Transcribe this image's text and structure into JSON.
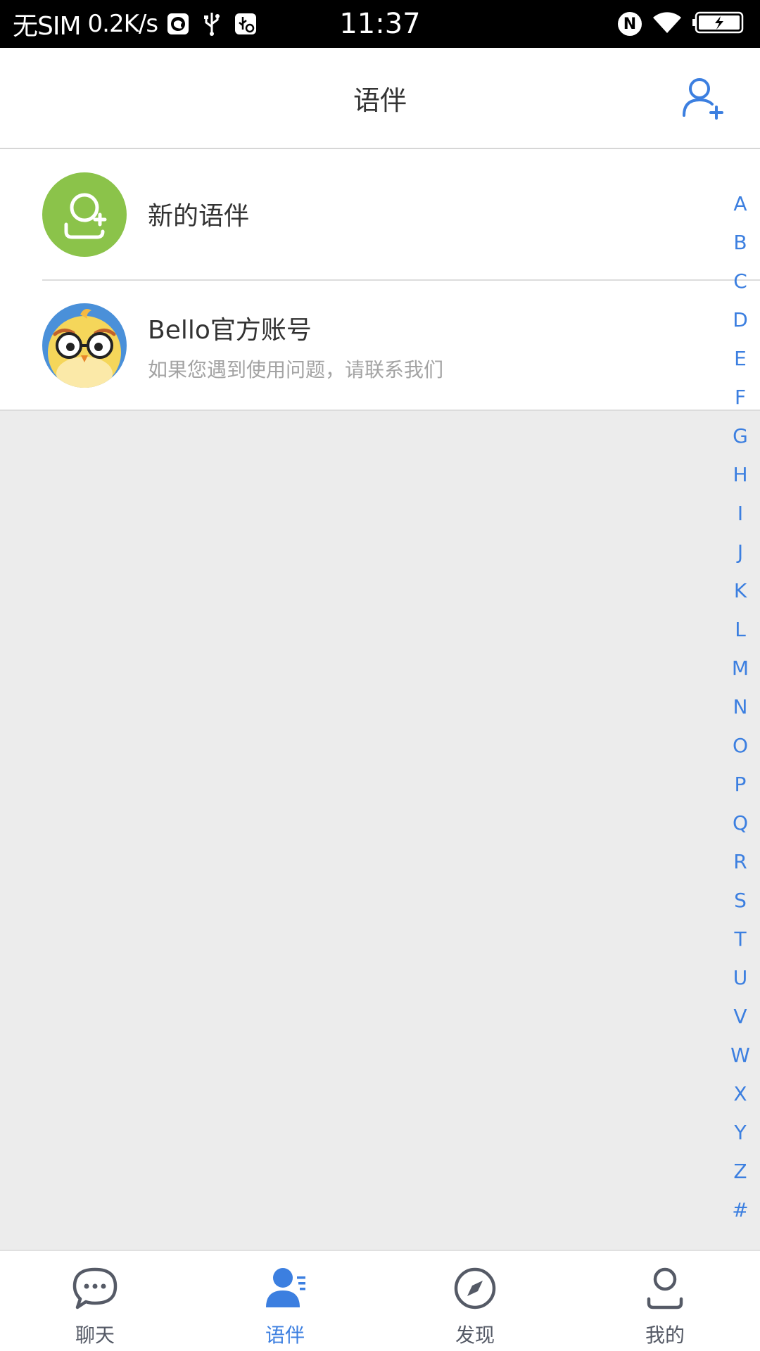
{
  "status_bar": {
    "carrier": "无SIM",
    "speed": "0.2K/s",
    "time": "11:37",
    "nfc": "N"
  },
  "header": {
    "title": "语伴"
  },
  "list": {
    "new_friends": {
      "title": "新的语伴"
    },
    "official": {
      "title": "Bello官方账号",
      "subtitle": "如果您遇到使用问题，请联系我们"
    }
  },
  "alpha_index": [
    "A",
    "B",
    "C",
    "D",
    "E",
    "F",
    "G",
    "H",
    "I",
    "J",
    "K",
    "L",
    "M",
    "N",
    "O",
    "P",
    "Q",
    "R",
    "S",
    "T",
    "U",
    "V",
    "W",
    "X",
    "Y",
    "Z",
    "#"
  ],
  "tabs": [
    {
      "label": "聊天",
      "icon": "chat-bubble-icon",
      "active": false
    },
    {
      "label": "语伴",
      "icon": "contacts-icon",
      "active": true
    },
    {
      "label": "发现",
      "icon": "compass-icon",
      "active": false
    },
    {
      "label": "我的",
      "icon": "person-icon",
      "active": false
    }
  ],
  "colors": {
    "accent": "#3c7fe0",
    "new_friend_bg": "#8bc34a",
    "background": "#ececec"
  }
}
